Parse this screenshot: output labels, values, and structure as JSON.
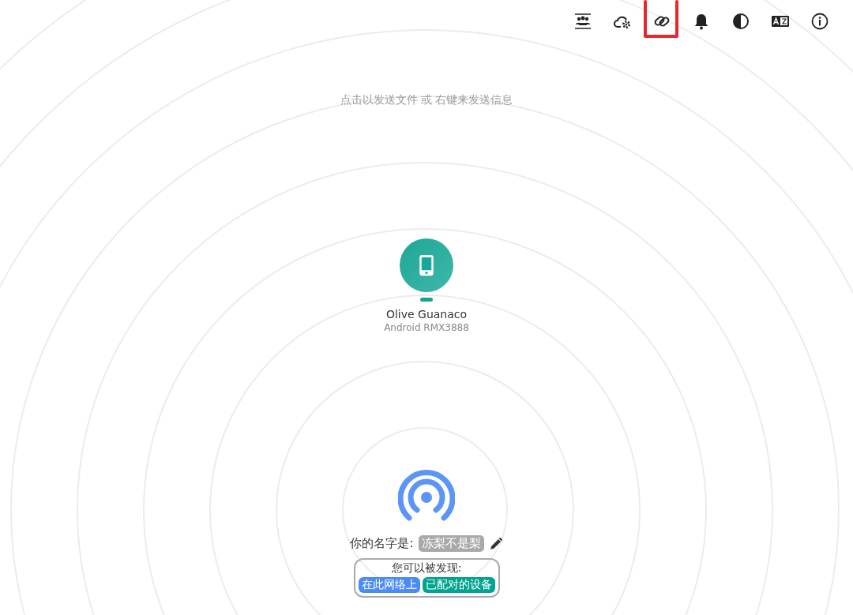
{
  "toolbar": [
    {
      "kind": "people",
      "highlighted": false
    },
    {
      "kind": "cloud-gear",
      "highlighted": false
    },
    {
      "kind": "link",
      "highlighted": true
    },
    {
      "kind": "bell",
      "highlighted": false
    },
    {
      "kind": "contrast",
      "highlighted": false
    },
    {
      "kind": "language",
      "highlighted": false
    },
    {
      "kind": "info",
      "highlighted": false
    }
  ],
  "hint": "点击以发送文件 或 右键来发送信息",
  "peer": {
    "name": "Olive Guanaco",
    "device": "Android RMX3888"
  },
  "self": {
    "name_label": "你的名字是:",
    "name": "冻梨不是梨",
    "discovery_label": "您可以被发现:",
    "badges": [
      {
        "label": "在此网络上",
        "color": "#4c8bf5"
      },
      {
        "label": "已配对的设备",
        "color": "#00a48f"
      }
    ]
  }
}
